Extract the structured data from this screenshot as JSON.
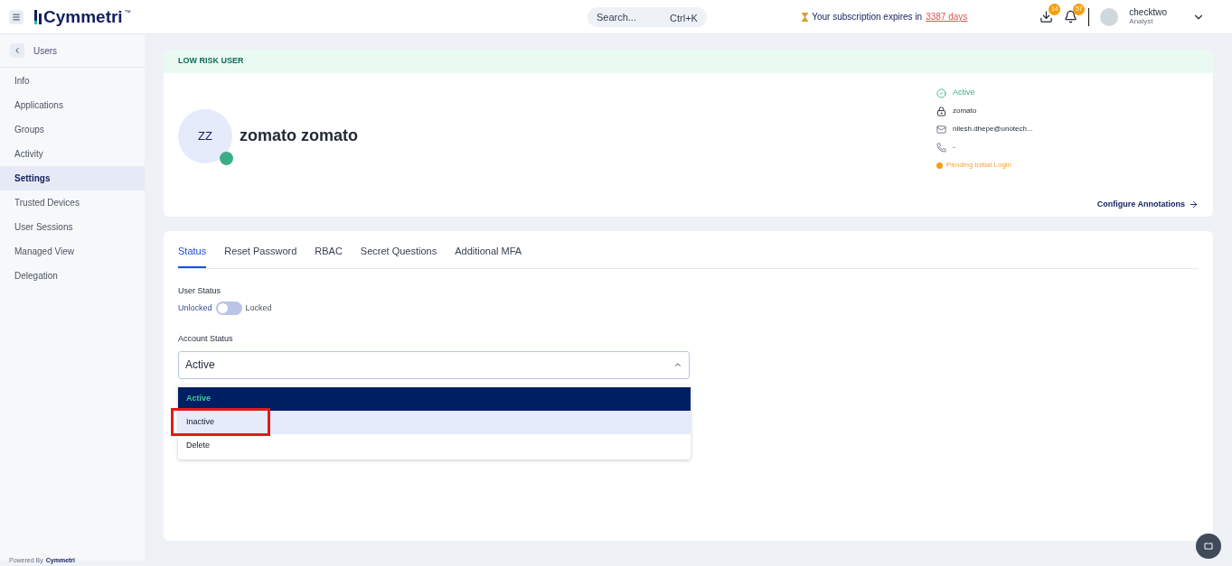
{
  "header": {
    "logo": "Cymmetri",
    "trademark": "™",
    "search": {
      "placeholder": "Search...",
      "shortcut": "Ctrl+K"
    },
    "subscription": {
      "text": "Your subscription expires in",
      "link": "3387 days"
    },
    "downloads_badge": "14",
    "notifications_badge": "57",
    "user": {
      "name": "checktwo",
      "role": "Analyst"
    }
  },
  "sidebar": {
    "back_label": "Users",
    "items": [
      {
        "label": "Info",
        "selected": false
      },
      {
        "label": "Applications",
        "selected": false
      },
      {
        "label": "Groups",
        "selected": false
      },
      {
        "label": "Activity",
        "selected": false
      },
      {
        "label": "Settings",
        "selected": true
      },
      {
        "label": "Trusted Devices",
        "selected": false
      },
      {
        "label": "User Sessions",
        "selected": false
      },
      {
        "label": "Managed View",
        "selected": false
      },
      {
        "label": "Delegation",
        "selected": false
      }
    ],
    "footer": {
      "text": "Powered By",
      "logo": "Cymmetri"
    }
  },
  "profile": {
    "risk_label": "LOW RISK USER",
    "initials": "ZZ",
    "online": true,
    "name": "zomato zomato",
    "status": "Active",
    "username": "zomato",
    "email": "nilesh.dhepe@unotech...",
    "phone": "-",
    "notice": "Pending Initial Login",
    "action": "Configure Annotations"
  },
  "tabs": [
    {
      "label": "Status",
      "selected": true
    },
    {
      "label": "Reset Password",
      "selected": false
    },
    {
      "label": "RBAC",
      "selected": false
    },
    {
      "label": "Secret Questions",
      "selected": false
    },
    {
      "label": "Additional MFA",
      "selected": false
    }
  ],
  "user_status": {
    "label": "User Status",
    "off_label": "Unlocked",
    "on_label": "Locked",
    "on": false
  },
  "account_status": {
    "label": "Account Status",
    "value": "Active",
    "expanded": true,
    "options": [
      {
        "label": "Active",
        "selected": true,
        "highlighted": false,
        "marked": false
      },
      {
        "label": "Inactive",
        "selected": false,
        "highlighted": true,
        "marked": true
      },
      {
        "label": "Delete",
        "selected": false,
        "highlighted": false,
        "marked": false
      }
    ]
  }
}
